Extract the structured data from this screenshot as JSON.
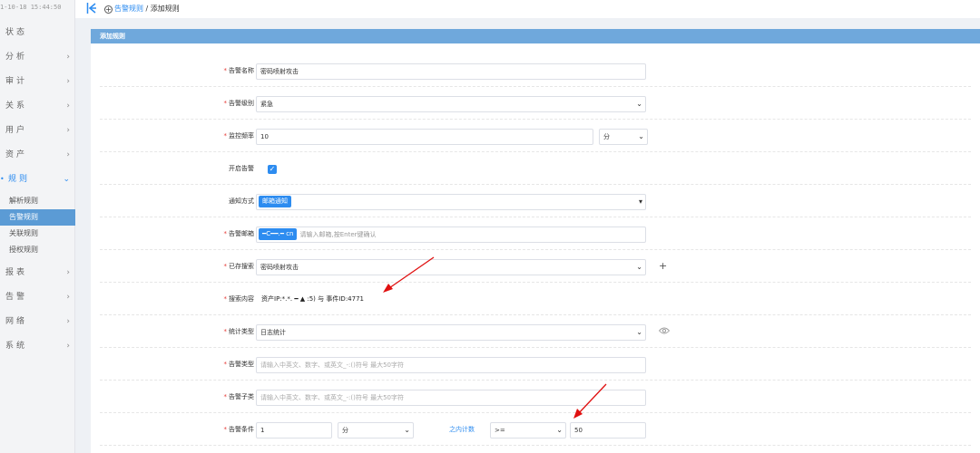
{
  "header": {
    "clock": "1-10-18 15:44:50",
    "breadcrumb_parent": "告警规则",
    "breadcrumb_sep": " / ",
    "breadcrumb_current": "添加规则"
  },
  "sidebar": {
    "items": [
      {
        "label": "状态"
      },
      {
        "label": "分析",
        "chevron": "›"
      },
      {
        "label": "审计",
        "chevron": "›"
      },
      {
        "label": "关系",
        "chevron": "›"
      },
      {
        "label": "用户",
        "chevron": "›"
      },
      {
        "label": "资产",
        "chevron": "›"
      },
      {
        "label": "规则",
        "chevron": "⌄",
        "dot": "•"
      },
      {
        "label": "报表",
        "chevron": "›"
      },
      {
        "label": "告警",
        "chevron": "›"
      },
      {
        "label": "网络",
        "chevron": "›"
      },
      {
        "label": "系统",
        "chevron": "›"
      }
    ],
    "subitems": [
      "解析规则",
      "告警规则",
      "关联规则",
      "授权规则"
    ]
  },
  "panel": {
    "title": "添加规则"
  },
  "form": {
    "colon": ":",
    "required_mark": "*",
    "alert_name": {
      "label": "告警名称",
      "value": "密码喷射攻击"
    },
    "alert_level": {
      "label": "告警级别",
      "value": "紧急"
    },
    "monitor_freq": {
      "label": "监控频率",
      "value": "10",
      "unit": "分"
    },
    "enable_alert": {
      "label": "开启告警",
      "checked": true
    },
    "notify_method": {
      "label": "通知方式",
      "tag": "邮箱通知"
    },
    "alert_email": {
      "label": "告警邮箱",
      "tag": "━C━━.━ cn",
      "placeholder": "请输入邮箱,按Enter键确认"
    },
    "saved_search": {
      "label": "已存搜索",
      "value": "密码喷射攻击"
    },
    "search_content": {
      "label": "搜索内容",
      "value": "资产IP:*.*. ━  ▲ :5) 与 事件ID:4771"
    },
    "stat_type": {
      "label": "统计类型",
      "value": "日志统计"
    },
    "alert_type": {
      "label": "告警类型",
      "placeholder": "请输入中英文、数字、或英文_-:()符号  最大50字符"
    },
    "alert_subtype": {
      "label": "告警子类",
      "placeholder": "请输入中英文、数字、或英文_-:()符号  最大50字符"
    },
    "alert_condition": {
      "label": "告警条件",
      "value": "1",
      "unit": "分",
      "link": "之内计数",
      "op": ">=",
      "threshold": "50"
    }
  },
  "colors": {
    "accent": "#2d8cf0",
    "panel_header": "#6fa8dc",
    "required": "#e53935",
    "arrow": "#e01010"
  }
}
